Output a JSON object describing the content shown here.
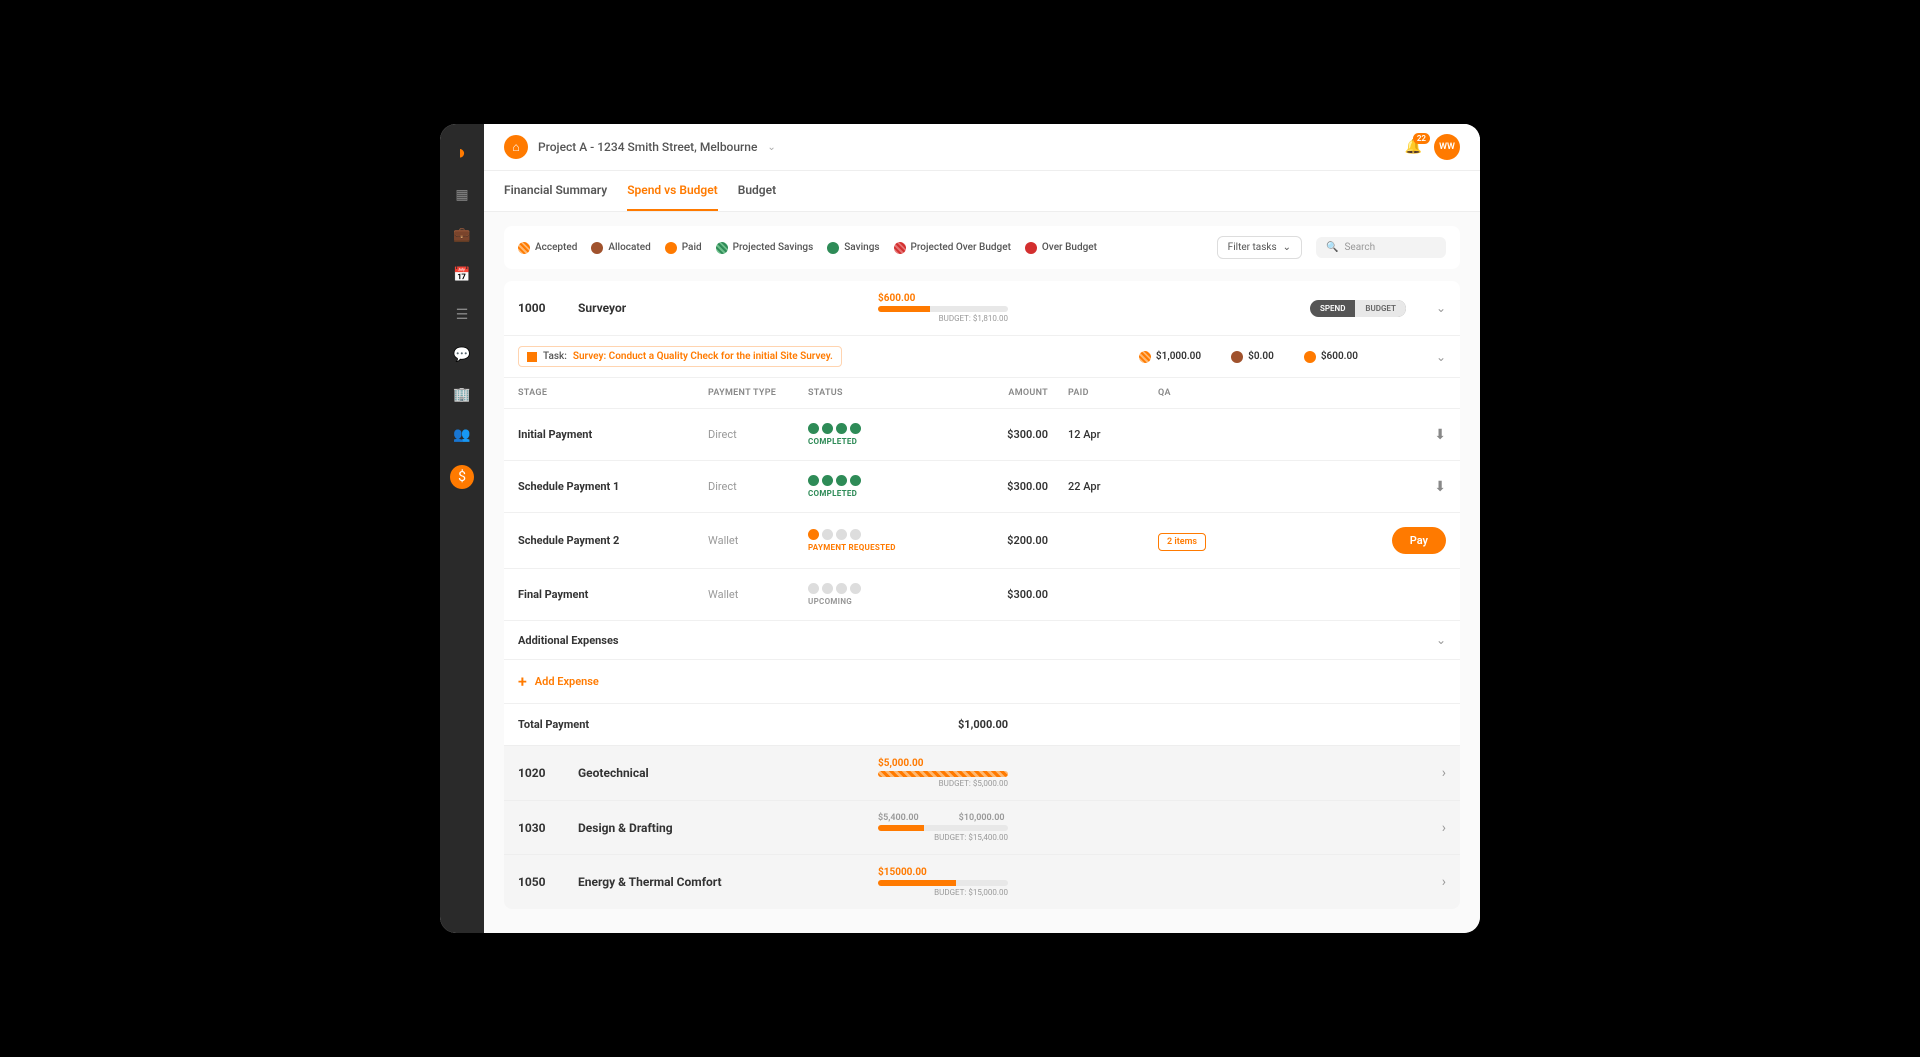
{
  "header": {
    "project_title": "Project A - 1234 Smith Street, Melbourne",
    "notification_count": "22",
    "avatar_initials": "WW"
  },
  "tabs": {
    "financial_summary": "Financial Summary",
    "spend_vs_budget": "Spend vs Budget",
    "budget": "Budget"
  },
  "legend": {
    "accepted": "Accepted",
    "allocated": "Allocated",
    "paid": "Paid",
    "projected_savings": "Projected Savings",
    "savings": "Savings",
    "projected_over": "Projected Over Budget",
    "over_budget": "Over Budget"
  },
  "filter_label": "Filter tasks",
  "search_placeholder": "Search",
  "toggle": {
    "spend": "SPEND",
    "budget": "BUDGET"
  },
  "section_main": {
    "code": "1000",
    "name": "Surveyor",
    "spend": "$600.00",
    "budget_label": "BUDGET: $1,810.00"
  },
  "task": {
    "prefix": "Task:",
    "name": "Survey: Conduct a Quality Check for the initial Site Survey.",
    "amt_accepted": "$1,000.00",
    "amt_allocated": "$0.00",
    "amt_paid": "$600.00"
  },
  "columns": {
    "stage": "STAGE",
    "payment_type": "PAYMENT TYPE",
    "status": "STATUS",
    "amount": "AMOUNT",
    "paid": "PAID",
    "qa": "QA"
  },
  "rows": [
    {
      "stage": "Initial Payment",
      "ptype": "Direct",
      "status": "COMPLETED",
      "status_class": "completed",
      "dots": [
        "green",
        "green",
        "green",
        "green"
      ],
      "amount": "$300.00",
      "paid": "12 Apr",
      "qa": "",
      "action": "download"
    },
    {
      "stage": "Schedule Payment 1",
      "ptype": "Direct",
      "status": "COMPLETED",
      "status_class": "completed",
      "dots": [
        "green",
        "green",
        "green",
        "green"
      ],
      "amount": "$300.00",
      "paid": "22 Apr",
      "qa": "",
      "action": "download"
    },
    {
      "stage": "Schedule Payment 2",
      "ptype": "Wallet",
      "status": "PAYMENT REQUESTED",
      "status_class": "requested",
      "dots": [
        "orange",
        "grey",
        "grey",
        "grey"
      ],
      "amount": "$200.00",
      "paid": "",
      "qa": "2 items",
      "action": "pay"
    },
    {
      "stage": "Final Payment",
      "ptype": "Wallet",
      "status": "UPCOMING",
      "status_class": "upcoming",
      "dots": [
        "grey",
        "grey",
        "grey",
        "grey"
      ],
      "amount": "$300.00",
      "paid": "",
      "qa": "",
      "action": ""
    }
  ],
  "additional_expenses": "Additional Expenses",
  "add_expense": "Add Expense",
  "total": {
    "label": "Total Payment",
    "value": "$1,000.00"
  },
  "pay_label": "Pay",
  "other_sections": [
    {
      "code": "1020",
      "name": "Geotechnical",
      "spend": "$5,000.00",
      "budget": "BUDGET: $5,000.00",
      "fill_type": "stripe",
      "fill_pct": 100
    },
    {
      "code": "1030",
      "name": "Design & Drafting",
      "spend": "$5,400.00",
      "split": "$10,000.00",
      "budget": "BUDGET: $15,400.00",
      "fill_type": "solid",
      "fill_pct": 35
    },
    {
      "code": "1050",
      "name": "Energy & Thermal Comfort",
      "spend": "$15000.00",
      "budget": "BUDGET: $15,000.00",
      "fill_type": "solid",
      "fill_pct": 60
    }
  ]
}
